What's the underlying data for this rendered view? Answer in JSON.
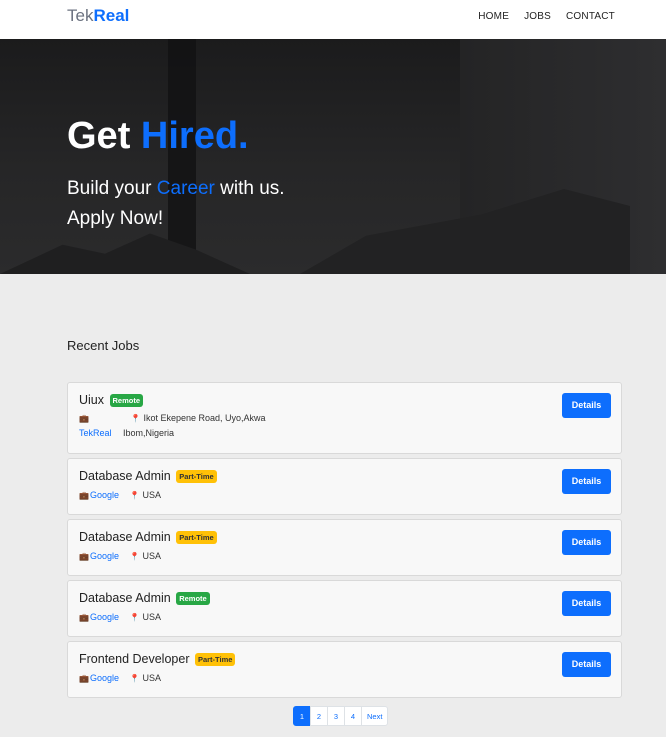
{
  "brand": {
    "part1": "Tek",
    "part2": "Real"
  },
  "nav": {
    "home": "HOME",
    "jobs": "JOBS",
    "contact": "CONTACT"
  },
  "hero": {
    "title_part1": "Get",
    "title_part2": "Hired.",
    "line1_part1": "Build your",
    "line1_accent": "Career",
    "line1_part2": "with us.",
    "line2": "Apply Now!"
  },
  "section_title": "Recent Jobs",
  "jobs": [
    {
      "title": "Uiux",
      "badge": "Remote",
      "company": "TekReal",
      "location_line1": "Ikot Ekepene Road, Uyo,Akwa",
      "location_line2": "Ibom,Nigeria",
      "details": "Details"
    },
    {
      "title": "Database Admin",
      "badge": "Part-Time",
      "company": "Google",
      "location": "USA",
      "details": "Details"
    },
    {
      "title": "Database Admin",
      "badge": "Part-Time",
      "company": "Google",
      "location": "USA",
      "details": "Details"
    },
    {
      "title": "Database Admin",
      "badge": "Remote",
      "company": "Google",
      "location": "USA",
      "details": "Details"
    },
    {
      "title": "Frontend Developer",
      "badge": "Part-Time",
      "company": "Google",
      "location": "USA",
      "details": "Details"
    }
  ],
  "pagination": {
    "pages": [
      "1",
      "2",
      "3",
      "4"
    ],
    "next": "Next",
    "active": "1"
  },
  "icons": {
    "company": "briefcase-icon",
    "location": "map-pin-icon"
  },
  "colors": {
    "accent": "#0d6efd",
    "remote": "#28a745",
    "parttime": "#ffc107"
  }
}
